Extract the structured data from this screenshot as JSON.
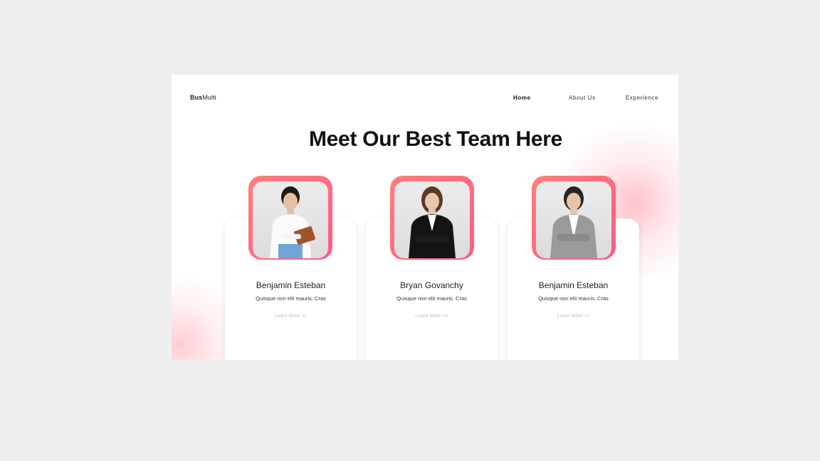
{
  "brand": {
    "bold": "Bus",
    "rest": "Multi"
  },
  "nav": [
    {
      "label": "Home",
      "active": true
    },
    {
      "label": "About Us",
      "active": false
    },
    {
      "label": "Experience",
      "active": false
    }
  ],
  "headline": "Meet Our Best Team Here",
  "team": [
    {
      "name": "Benjamin Esteban",
      "description": "Quisque non elit mauris. Cras",
      "link": "Learn More >>"
    },
    {
      "name": "Bryan Govanchy",
      "description": "Quisque non elit mauris. Cras",
      "link": "Learn More >>"
    },
    {
      "name": "Benjamin Esteban",
      "description": "Quisque non elit mauris. Cras",
      "link": "Learn More >>"
    }
  ],
  "colors": {
    "accent_start": "#ff7f7a",
    "accent_end": "#ff5a8a",
    "page_bg": "#efefef"
  }
}
